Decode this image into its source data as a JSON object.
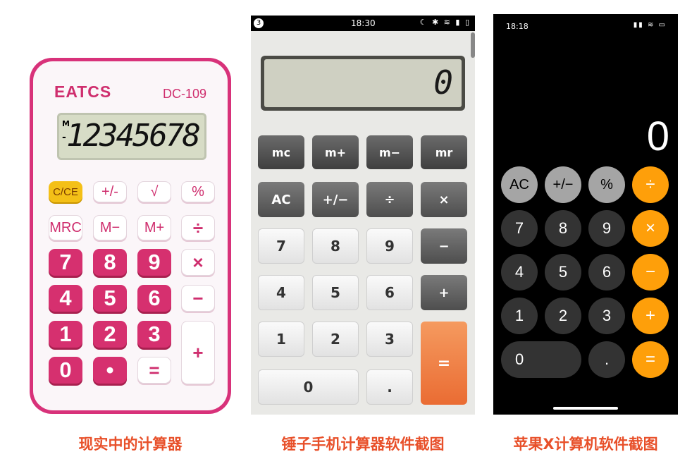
{
  "physical": {
    "brand": "EATCS",
    "model": "DC-109",
    "lcd_m": "M",
    "lcd_minus": "-",
    "lcd_value": "12345678",
    "keys": [
      "C/CE",
      "+/-",
      "√",
      "%",
      "MRC",
      "M−",
      "M+",
      "÷",
      "7",
      "8",
      "9",
      "×",
      "4",
      "5",
      "6",
      "−",
      "1",
      "2",
      "3",
      "+",
      "0",
      "•",
      "="
    ]
  },
  "hammer": {
    "status": {
      "badge": "3",
      "time": "18:30",
      "icons": "☾ ✱ ≋ ▮ ▯"
    },
    "display": "0",
    "keys": [
      "mc",
      "m+",
      "m−",
      "mr",
      "AC",
      "+/−",
      "÷",
      "×",
      "7",
      "8",
      "9",
      "−",
      "4",
      "5",
      "6",
      "+",
      "1",
      "2",
      "3",
      "=",
      "0",
      "."
    ]
  },
  "iphone": {
    "status": {
      "time": "18:18",
      "icons": "▮▮ ≋ ▭"
    },
    "display": "0",
    "keys": [
      "AC",
      "+/−",
      "%",
      "÷",
      "7",
      "8",
      "9",
      "×",
      "4",
      "5",
      "6",
      "−",
      "1",
      "2",
      "3",
      "+",
      "0",
      ".",
      "="
    ]
  },
  "captions": {
    "left": "现实中的计算器",
    "middle": "锤子手机计算器软件截图",
    "right": "苹果X计算机软件截图"
  }
}
